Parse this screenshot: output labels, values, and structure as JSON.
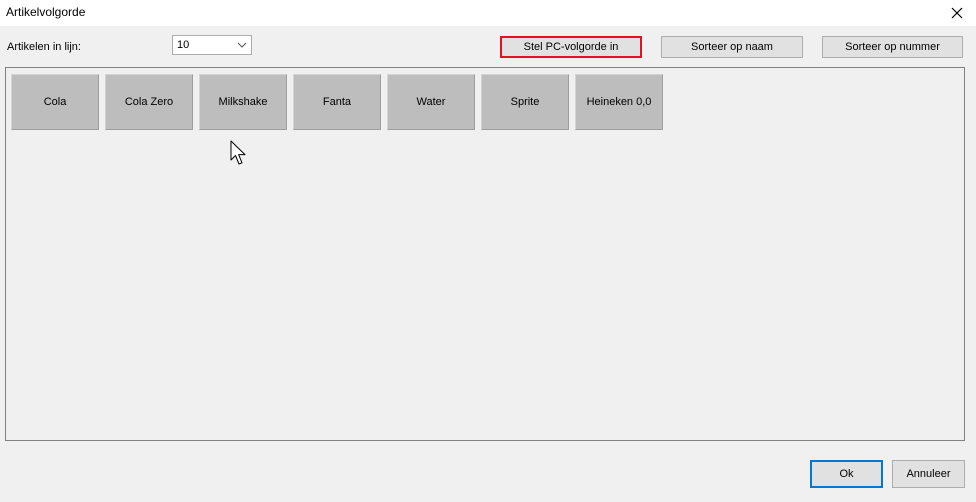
{
  "window": {
    "title": "Artikelvolgorde"
  },
  "toolbar": {
    "items_per_row_label": "Artikelen in lijn:",
    "items_per_row_value": "10",
    "set_pc_order_label": "Stel PC-volgorde in",
    "sort_by_name_label": "Sorteer op naam",
    "sort_by_number_label": "Sorteer op nummer"
  },
  "articles": [
    {
      "label": "Cola"
    },
    {
      "label": "Cola Zero"
    },
    {
      "label": "Milkshake"
    },
    {
      "label": "Fanta"
    },
    {
      "label": "Water"
    },
    {
      "label": "Sprite"
    },
    {
      "label": "Heineken 0,0"
    }
  ],
  "footer": {
    "ok_label": "Ok",
    "cancel_label": "Annuleer"
  },
  "colors": {
    "highlight_border": "#e0141e",
    "default_button_border": "#0078d7",
    "tile_background": "#bdbdbd",
    "window_background": "#f0f0f0"
  },
  "icons": {
    "close": "close-icon",
    "dropdown": "chevron-down-icon",
    "cursor": "mouse-pointer-icon"
  }
}
